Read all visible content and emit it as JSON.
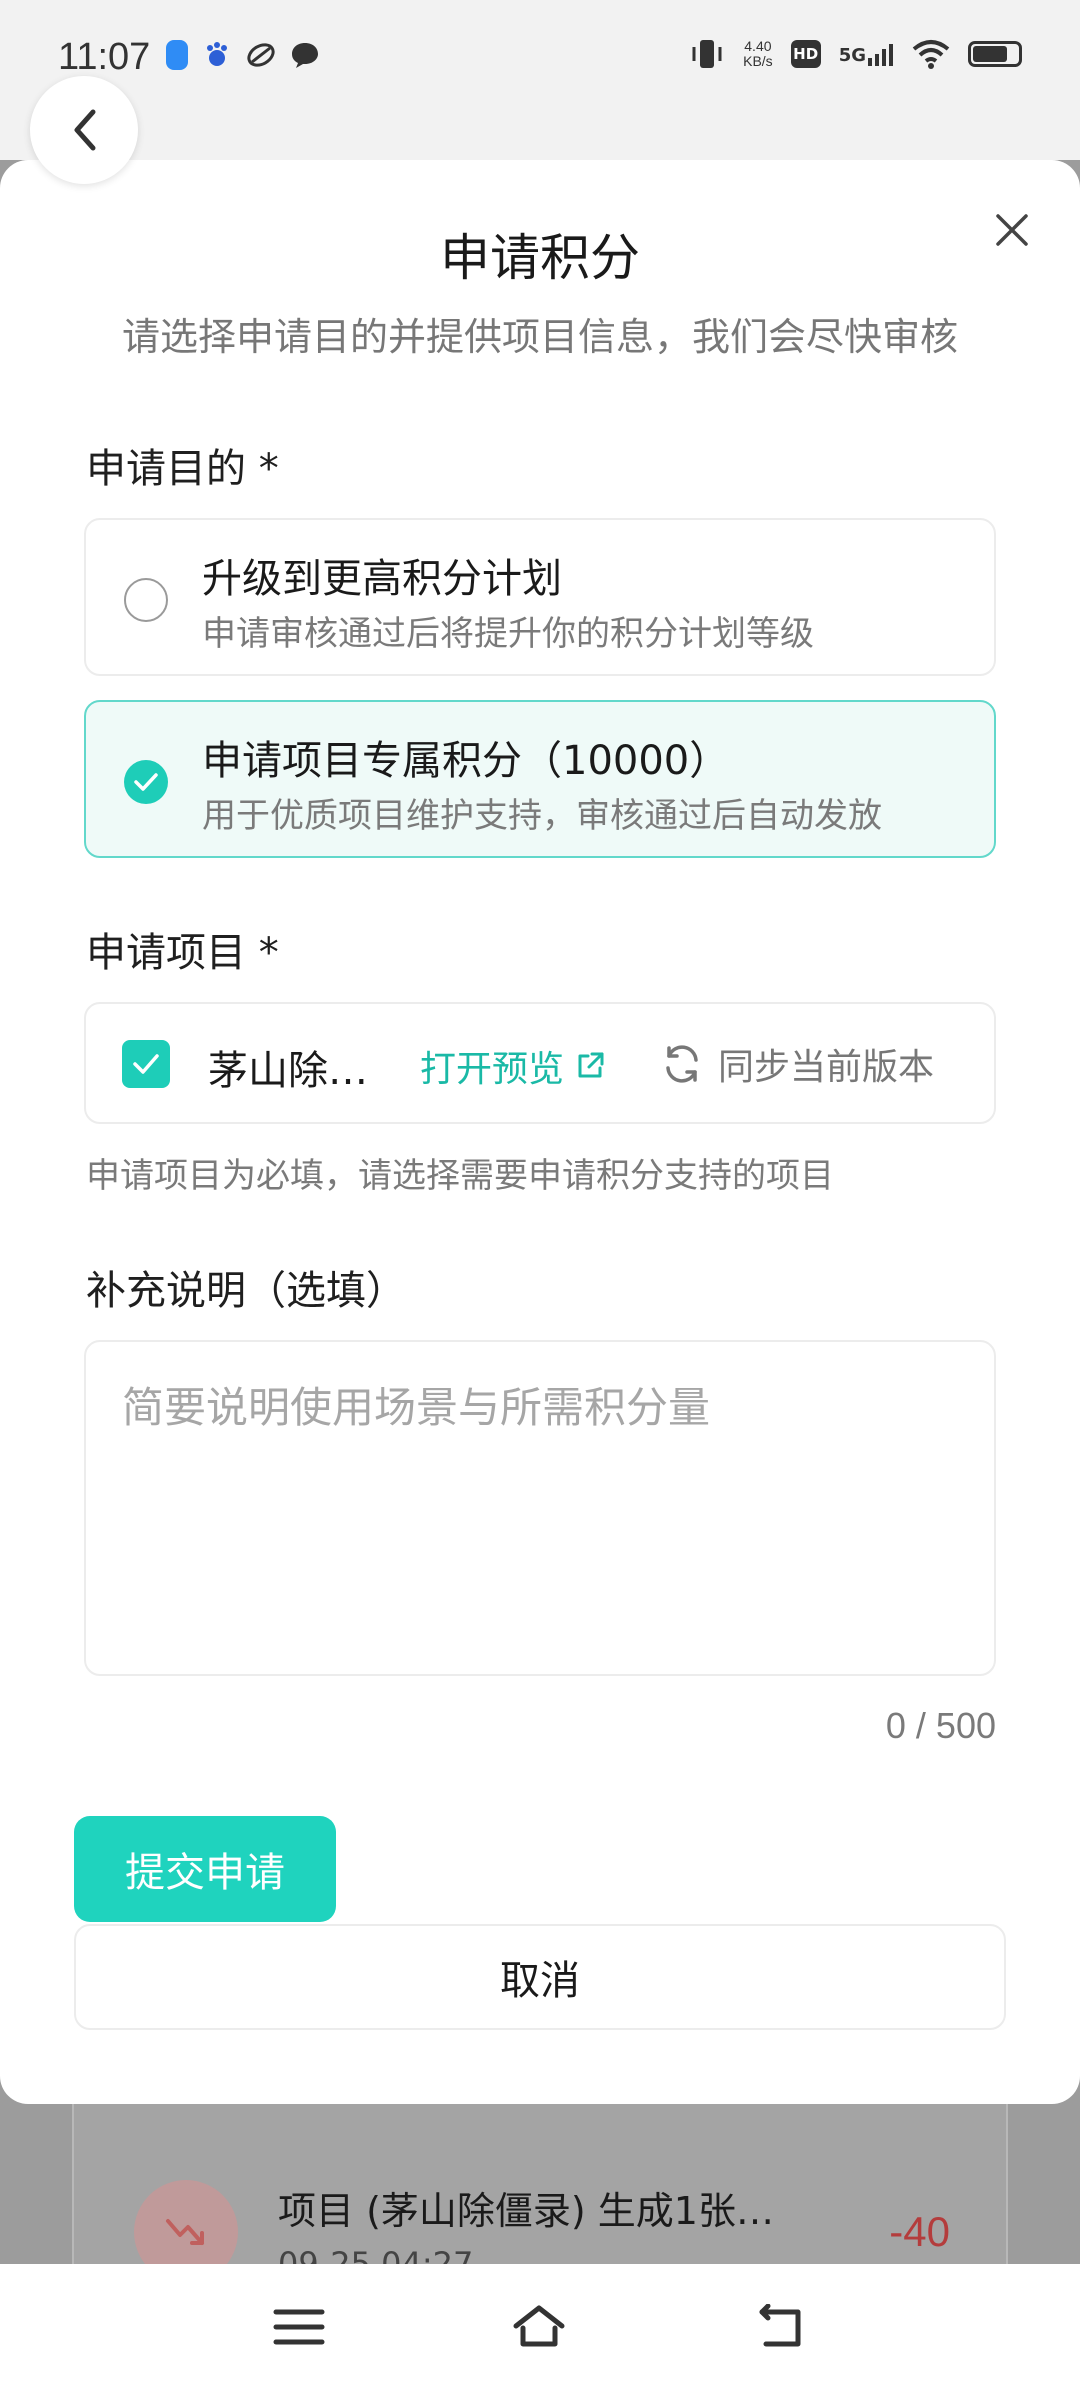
{
  "status_bar": {
    "time": "11:07",
    "net_speed_value": "4.40",
    "net_speed_unit": "KB/s",
    "hd": "HD",
    "network": "5G"
  },
  "modal": {
    "title": "申请积分",
    "subtitle": "请选择申请目的并提供项目信息，我们会尽快审核",
    "purpose_label": "申请目的 *",
    "options": [
      {
        "title": "升级到更高积分计划",
        "desc": "申请审核通过后将提升你的积分计划等级",
        "selected": false
      },
      {
        "title": "申请项目专属积分（10000）",
        "desc": "用于优质项目维护支持，审核通过后自动发放",
        "selected": true
      }
    ],
    "project_label": "申请项目 *",
    "project": {
      "name": "茅山除…",
      "preview_label": "打开预览",
      "sync_label": "同步当前版本",
      "checked": true
    },
    "project_hint": "申请项目为必填，请选择需要申请积分支持的项目",
    "notes_label": "补充说明（选填）",
    "notes_placeholder": "简要说明使用场景与所需积分量",
    "notes_counter": "0 / 500",
    "submit_label": "提交申请",
    "cancel_label": "取消"
  },
  "background_item": {
    "title": "项目 (茅山除僵录) 生成1张…",
    "time": "09-25 04:27",
    "amount": "-40"
  },
  "colors": {
    "accent": "#1fd3be",
    "accent_text": "#1ab9a6",
    "selected_bg": "#effaf8",
    "negative": "#b43c3c"
  }
}
